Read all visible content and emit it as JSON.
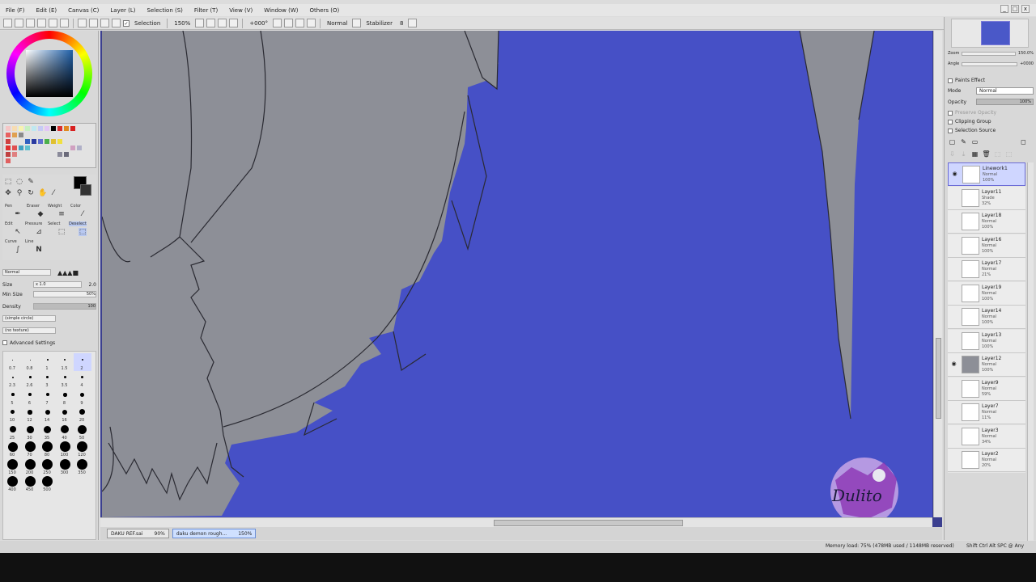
{
  "menu": [
    "File (F)",
    "Edit (E)",
    "Canvas (C)",
    "Layer (L)",
    "Selection (S)",
    "Filter (T)",
    "View (V)",
    "Window (W)",
    "Others (O)"
  ],
  "window_controls": [
    "_",
    "□",
    "x"
  ],
  "toolbar": {
    "selection_label": "Selection",
    "zoom": "150%",
    "angle": "+000°",
    "mode": "Normal",
    "stabilizer_label": "Stabilizer",
    "stabilizer_value": "8"
  },
  "tools": {
    "pen": "Pen",
    "eraser": "Eraser",
    "weight": "Weight",
    "color": "Color",
    "edit": "Edit",
    "pressure": "Pressure",
    "select": "Select",
    "deselect": "Deselect",
    "curve": "Curve",
    "line": "Line"
  },
  "brush": {
    "normal": "Normal",
    "size_label": "Size",
    "size_mult": "x 1.0",
    "size_value": "2.0",
    "min_size_label": "Min Size",
    "min_size_value": "50%",
    "density_label": "Density",
    "density_value": "100",
    "shape": "(simple circle)",
    "texture": "(no texture)",
    "advanced": "Advanced Settings",
    "presets": [
      "0.7",
      "0.8",
      "1",
      "1.5",
      "2",
      "2.3",
      "2.6",
      "3",
      "3.5",
      "4",
      "5",
      "6",
      "7",
      "8",
      "9",
      "10",
      "12",
      "14",
      "16",
      "20",
      "25",
      "30",
      "35",
      "40",
      "50",
      "60",
      "70",
      "80",
      "100",
      "120",
      "150",
      "200",
      "250",
      "300",
      "350",
      "400",
      "450",
      "500"
    ]
  },
  "navigator": {
    "zoom_label": "Zoom",
    "zoom_value": "150.0%",
    "angle_label": "Angle",
    "angle_value": "+0000"
  },
  "layer_panel": {
    "paints_effect": "Paints Effect",
    "mode_label": "Mode",
    "mode_value": "Normal",
    "opacity_label": "Opacity",
    "opacity_value": "100%",
    "preserve_opacity": "Preserve Opacity",
    "clipping_group": "Clipping Group",
    "selection_source": "Selection Source"
  },
  "layers": [
    {
      "name": "Linework1",
      "mode": "Normal",
      "opacity": "100%",
      "visible": true,
      "selected": true
    },
    {
      "name": "Layer11",
      "mode": "Shade",
      "opacity": "32%",
      "visible": false,
      "selected": false
    },
    {
      "name": "Layer18",
      "mode": "Normal",
      "opacity": "100%",
      "visible": false,
      "selected": false
    },
    {
      "name": "Layer16",
      "mode": "Normal",
      "opacity": "100%",
      "visible": false,
      "selected": false
    },
    {
      "name": "Layer17",
      "mode": "Normal",
      "opacity": "21%",
      "visible": false,
      "selected": false
    },
    {
      "name": "Layer19",
      "mode": "Normal",
      "opacity": "100%",
      "visible": false,
      "selected": false
    },
    {
      "name": "Layer14",
      "mode": "Normal",
      "opacity": "100%",
      "visible": false,
      "selected": false
    },
    {
      "name": "Layer13",
      "mode": "Normal",
      "opacity": "100%",
      "visible": false,
      "selected": false
    },
    {
      "name": "Layer12",
      "mode": "Normal",
      "opacity": "100%",
      "visible": true,
      "selected": false
    },
    {
      "name": "Layer9",
      "mode": "Normal",
      "opacity": "59%",
      "visible": false,
      "selected": false
    },
    {
      "name": "Layer7",
      "mode": "Normal",
      "opacity": "11%",
      "visible": false,
      "selected": false
    },
    {
      "name": "Layer3",
      "mode": "Normal",
      "opacity": "34%",
      "visible": false,
      "selected": false
    },
    {
      "name": "Layer2",
      "mode": "Normal",
      "opacity": "20%",
      "visible": false,
      "selected": false
    }
  ],
  "tabs": [
    {
      "name": "DAKU REF.sai",
      "zoom": "90%"
    },
    {
      "name": "daku demon rough...",
      "zoom": "150%"
    }
  ],
  "status": {
    "memory": "Memory load: 75% (478MB used / 1148MB reserved)",
    "right": "Shift Ctrl Alt SPC @ Any"
  },
  "watermark_text": "Dulito",
  "colors": {
    "canvas_blue": "#4650c6",
    "hair_gray": "#8d8f97",
    "line": "#2a2a32",
    "primary": "#000000"
  }
}
